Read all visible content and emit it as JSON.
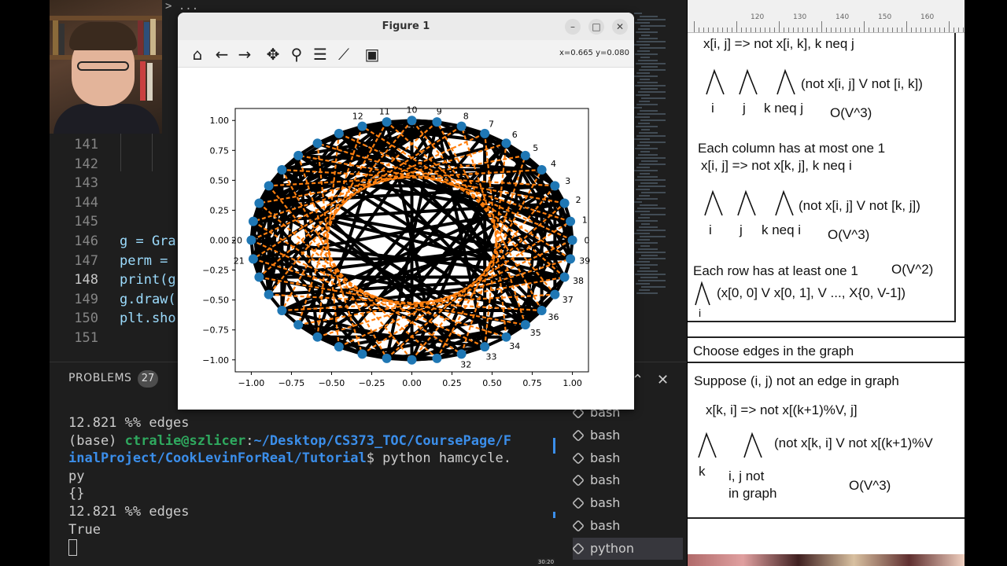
{
  "editor": {
    "breadcrumb": "> ...",
    "lines": [
      {
        "num": "141",
        "code": ""
      },
      {
        "num": "142",
        "code": ""
      },
      {
        "num": "143",
        "code": ""
      },
      {
        "num": "144",
        "code": ""
      },
      {
        "num": "145",
        "code": ""
      },
      {
        "num": "146",
        "code": "g = Gra"
      },
      {
        "num": "147",
        "code": "perm = "
      },
      {
        "num": "148",
        "code": "print(g"
      },
      {
        "num": "149",
        "code": "g.draw("
      },
      {
        "num": "150",
        "code": "plt.sho"
      },
      {
        "num": "151",
        "code": ""
      }
    ],
    "current_line": "148"
  },
  "panel": {
    "problems_label": "PROBLEMS",
    "problems_count": "27",
    "terminal": {
      "l1": "12.821 %% edges",
      "l2_prefix": "(base) ",
      "l2_user": "ctralie@szlicer",
      "l2_colon": ":",
      "l2_path": "~/Desktop/CS373_TOC/CoursePage/F",
      "l3_path": "inalProject/CookLevinForReal/Tutorial",
      "l3_rest": "$ python hamcycle.",
      "l4": "py",
      "l5": "{}",
      "l6": "12.821 %% edges",
      "l7": "True"
    },
    "terminals": [
      "bash",
      "bash",
      "bash",
      "bash",
      "bash",
      "bash",
      "python"
    ]
  },
  "figure": {
    "title": "Figure 1",
    "coords": "x=0.665 y=0.080",
    "toolbar": [
      "home-icon",
      "back-icon",
      "forward-icon",
      "pan-icon",
      "zoom-icon",
      "configure-icon",
      "edit-axis-icon",
      "save-icon"
    ]
  },
  "chart_data": {
    "type": "scatter",
    "title": "",
    "xlabel": "",
    "ylabel": "",
    "xlim": [
      -1.1,
      1.1
    ],
    "ylim": [
      -1.1,
      1.1
    ],
    "xticks": [
      "−1.00",
      "−0.75",
      "−0.50",
      "−0.25",
      "0.00",
      "0.25",
      "0.50",
      "0.75",
      "1.00"
    ],
    "yticks": [
      "1.00",
      "0.75",
      "0.50",
      "0.25",
      "0.00",
      "−0.25",
      "−0.50",
      "−0.75",
      "−1.00"
    ],
    "node_count": 40,
    "node_color": "#1f77b4",
    "edge_color": "#000000",
    "cycle_color": "#ff7f0e",
    "visible_node_labels": [
      "0",
      "1",
      "2",
      "3",
      "4",
      "5",
      "6",
      "7",
      "8",
      "9",
      "10",
      "11",
      "12",
      "20",
      "21",
      "32",
      "33",
      "34",
      "35",
      "36",
      "37",
      "38",
      "39"
    ]
  },
  "whiteboard": {
    "ruler_labels": [
      "120",
      "130",
      "140",
      "150",
      "160"
    ],
    "l1": "x[i, j] => not x[i, k], k neq j",
    "l2": "(not x[i, j] V not [i, k])",
    "l3a": "i",
    "l3b": "j",
    "l3c": "k neq j",
    "l3d": "O(V^3)",
    "l4": "Each column has at most one 1",
    "l5": "x[i, j] => not x[k, j], k neq i",
    "l6": "(not x[i, j] V not [k, j])",
    "l7a": "i",
    "l7b": "j",
    "l7c": "k neq i",
    "l7d": "O(V^3)",
    "l8": "Each row has at least one 1",
    "l8b": "O(V^2)",
    "l9": "(x[0, 0] V x[0, 1], V ..., X{0, V-1])",
    "l9i": "i",
    "l10": "Choose edges in the graph",
    "l11": "Suppose (i, j) not an edge in graph",
    "l12": "x[k, i] => not x[(k+1)%V, j]",
    "l13": "(not x[k, i] V not x[(k+1)%V",
    "l14a": "k",
    "l14b": "i, j not",
    "l14c": "in graph",
    "l14d": "O(V^3)"
  },
  "timestamp": "30:20"
}
